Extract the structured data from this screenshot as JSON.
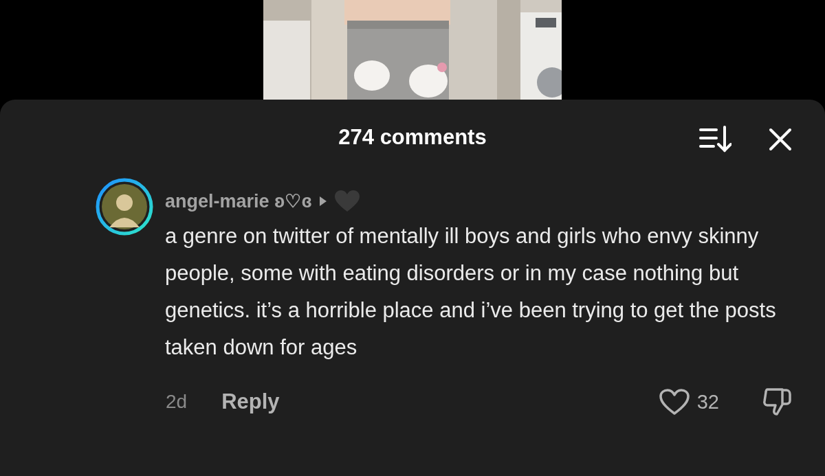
{
  "header": {
    "title": "274 comments"
  },
  "comment": {
    "username": "angel-marie ʚ♡ɞ",
    "text": "a genre on twitter of mentally ill boys and girls who envy skinny people, some with eating disorders or in my case nothing but genetics. it’s a horrible place and i’ve been trying to get the posts taken down for ages",
    "age": "2d",
    "reply": "Reply",
    "likes": "32",
    "liked": false
  }
}
